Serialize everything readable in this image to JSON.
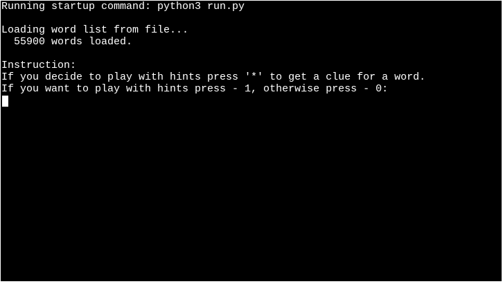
{
  "terminal": {
    "lines": [
      "Running startup command: python3 run.py",
      "",
      "Loading word list from file...",
      "  55900 words loaded.",
      "",
      "Instruction:",
      "If you decide to play with hints press '*' to get a clue for a word.",
      "If you want to play with hints press - 1, otherwise press - 0:"
    ],
    "colors": {
      "background": "#000000",
      "foreground": "#ffffff"
    }
  }
}
